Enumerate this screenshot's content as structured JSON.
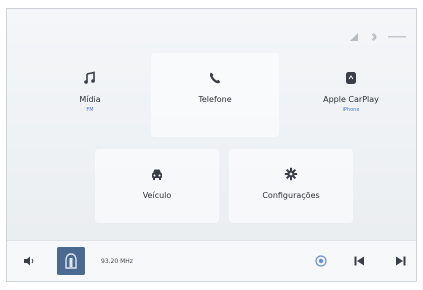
{
  "home": {
    "tiles": [
      {
        "key": "media",
        "label": "Mídia",
        "sub": "FM",
        "icon": "music-note-icon"
      },
      {
        "key": "phone",
        "label": "Telefone",
        "sub": "",
        "icon": "phone-icon"
      },
      {
        "key": "carplay",
        "label": "Apple CarPlay",
        "sub": "iPhone",
        "icon": "carplay-icon"
      },
      {
        "key": "vehicle",
        "label": "Veículo",
        "sub": "",
        "icon": "car-icon"
      },
      {
        "key": "settings",
        "label": "Configurações",
        "sub": "",
        "icon": "gear-icon"
      }
    ]
  },
  "status": {
    "icons": [
      "signal-icon",
      "bluetooth-icon",
      "minus-line-icon"
    ]
  },
  "bottom_bar": {
    "frequency": "93.20 MHz",
    "icons": [
      "volume-icon",
      "radio-album-art-icon",
      "source-icon",
      "previous-track-icon",
      "next-track-icon"
    ]
  },
  "colors": {
    "accent": "#4d7bd1",
    "text": "#2b3038",
    "icon": "#3a3f47"
  }
}
